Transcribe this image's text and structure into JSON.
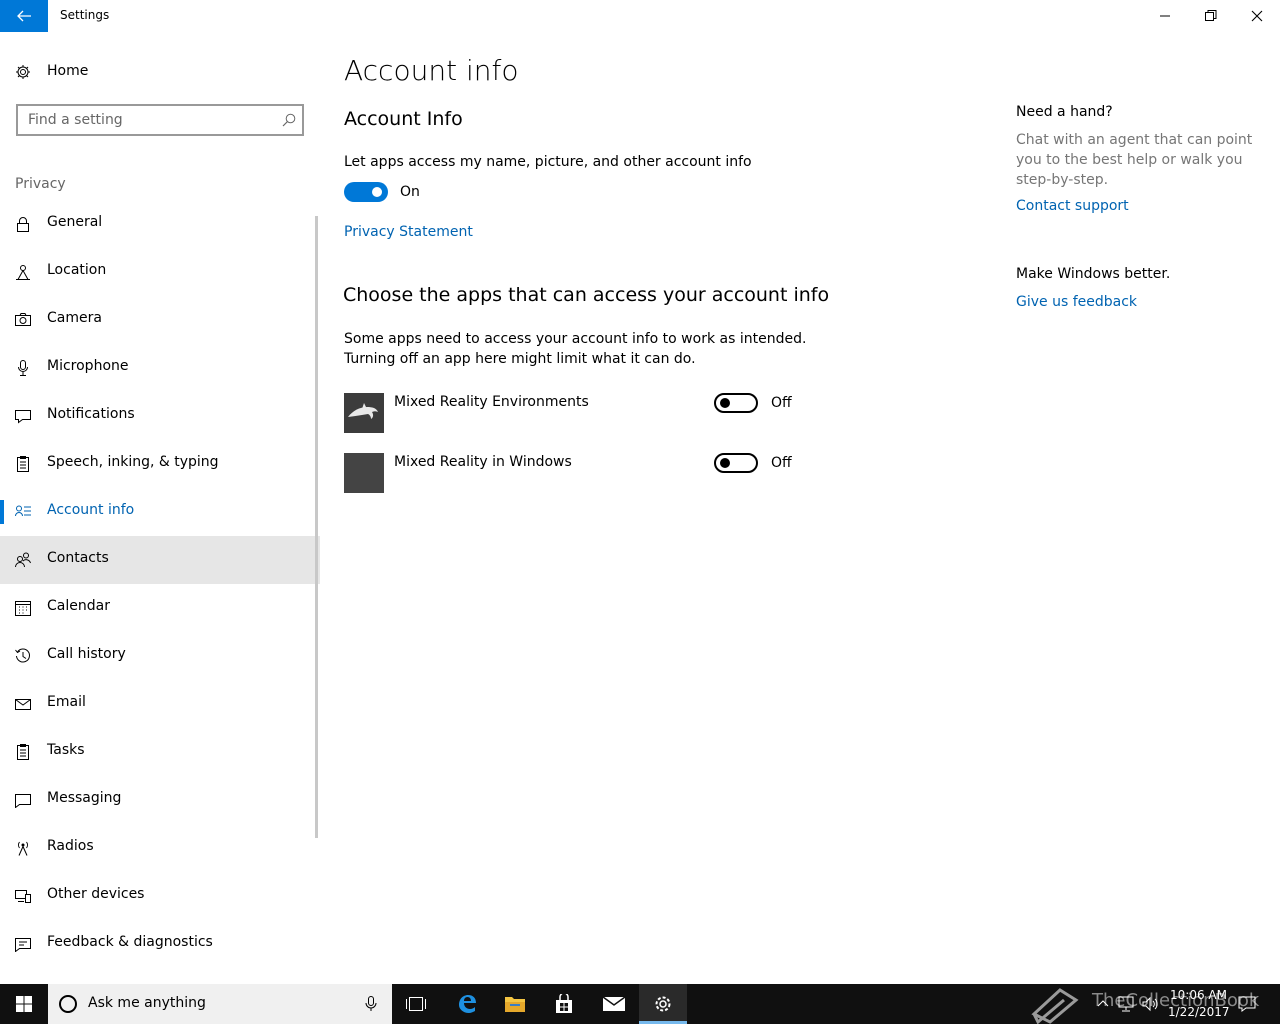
{
  "window": {
    "title": "Settings"
  },
  "sidebar": {
    "home_label": "Home",
    "search_placeholder": "Find a setting",
    "section_label": "Privacy",
    "items": [
      {
        "label": "General",
        "icon": "lock-icon"
      },
      {
        "label": "Location",
        "icon": "location-icon"
      },
      {
        "label": "Camera",
        "icon": "camera-icon"
      },
      {
        "label": "Microphone",
        "icon": "microphone-icon"
      },
      {
        "label": "Notifications",
        "icon": "notifications-icon"
      },
      {
        "label": "Speech, inking, & typing",
        "icon": "speech-icon"
      },
      {
        "label": "Account info",
        "icon": "account-info-icon",
        "selected": true
      },
      {
        "label": "Contacts",
        "icon": "contacts-icon",
        "hovered": true
      },
      {
        "label": "Calendar",
        "icon": "calendar-icon"
      },
      {
        "label": "Call history",
        "icon": "history-icon"
      },
      {
        "label": "Email",
        "icon": "email-icon"
      },
      {
        "label": "Tasks",
        "icon": "tasks-icon"
      },
      {
        "label": "Messaging",
        "icon": "messaging-icon"
      },
      {
        "label": "Radios",
        "icon": "radios-icon"
      },
      {
        "label": "Other devices",
        "icon": "devices-icon"
      },
      {
        "label": "Feedback & diagnostics",
        "icon": "feedback-icon"
      }
    ]
  },
  "main": {
    "page_title": "Account info",
    "section_title": "Account Info",
    "toggle_description": "Let apps access my name, picture, and other account info",
    "toggle_state": "On",
    "privacy_link": "Privacy Statement",
    "apps_heading": "Choose the apps that can access your account info",
    "apps_desc_line1": "Some apps need to access your account info to work as intended.",
    "apps_desc_line2": "Turning off an app here might limit what it can do.",
    "apps": [
      {
        "name": "Mixed Reality Environments",
        "state": "Off"
      },
      {
        "name": "Mixed Reality in Windows",
        "state": "Off"
      }
    ]
  },
  "aside": {
    "help_heading": "Need a hand?",
    "help_line1": "Chat with an agent that can point",
    "help_line2": "you to the best help or walk you",
    "help_line3": "step-by-step.",
    "contact_link": "Contact support",
    "feedback_heading": "Make Windows better.",
    "feedback_link": "Give us feedback"
  },
  "taskbar": {
    "search_placeholder": "Ask me anything",
    "time": "10:06 AM",
    "date": "1/22/2017",
    "watermark": "TheCollectionBook"
  },
  "colors": {
    "accent": "#0078d7",
    "link": "#0063b1",
    "taskbar": "#101010"
  }
}
